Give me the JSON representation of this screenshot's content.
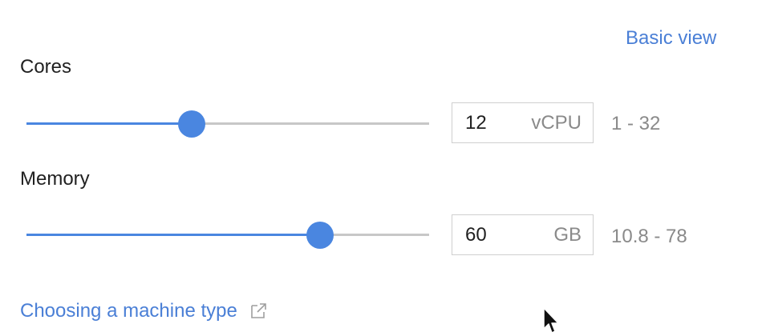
{
  "header": {
    "basic_view_link": "Basic view"
  },
  "cores": {
    "label": "Cores",
    "value": "12",
    "unit": "vCPU",
    "range": "1 - 32",
    "min": 1,
    "max": 32,
    "slider_fraction": 0.41
  },
  "memory": {
    "label": "Memory",
    "value": "60",
    "unit": "GB",
    "range": "10.8 - 78",
    "min": 10.8,
    "max": 78,
    "slider_fraction": 0.73
  },
  "footer": {
    "machine_type_link": "Choosing a machine type",
    "link_icon": "external-link-icon"
  },
  "colors": {
    "accent": "#4a86e0",
    "link": "#4a7fd6",
    "track": "#c7c7c7",
    "muted_text": "#8a8a8a"
  }
}
